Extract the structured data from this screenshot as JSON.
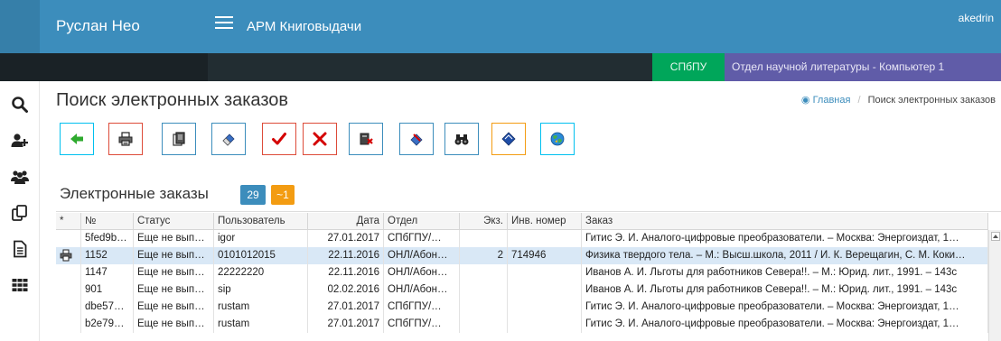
{
  "header": {
    "brand": "Руслан Нео",
    "app_title": "АРМ Книговыдачи",
    "user": "akedrin"
  },
  "infobar": {
    "org": "СПбПУ",
    "department": "Отдел научной литературы - Компьютер 1"
  },
  "sidebar": {
    "items": [
      "search-icon",
      "add-user-icon",
      "users-icon",
      "copy-icon",
      "document-icon",
      "grid-icon"
    ]
  },
  "page": {
    "title": "Поиск электронных заказов",
    "breadcrumb_home": "Главная",
    "breadcrumb_sep": "/",
    "breadcrumb_current": "Поиск электронных заказов"
  },
  "toolbar": {
    "buttons": [
      "back-arrow-icon",
      "print-icon",
      "copy-pages-icon",
      "eraser-icon",
      "checkmark-icon",
      "close-icon",
      "book-delete-icon",
      "book-mark-icon",
      "binoculars-icon",
      "diamond-icon",
      "globe-icon"
    ]
  },
  "section": {
    "title": "Электронные заказы",
    "count": "29",
    "new_count": "~1"
  },
  "grid": {
    "columns": [
      "*",
      "№",
      "Статус",
      "Пользователь",
      "Дата",
      "Отдел",
      "Экз.",
      "Инв. номер",
      "Заказ"
    ],
    "rows": [
      {
        "icon": "",
        "num": "5fed9b…",
        "status": "Еще не вып…",
        "user": "igor",
        "date": "27.01.2017",
        "dept": "СПбГПУ/…",
        "copies": "",
        "inv": "",
        "order": "Гитис Э. И. Аналого-цифровые преобразователи. – Москва: Энергоиздат, 1…"
      },
      {
        "icon": "printer",
        "num": "1152",
        "status": "Еще не вып…",
        "user": "0101012015",
        "date": "22.11.2016",
        "dept": "ОНЛ/Абон…",
        "copies": "2",
        "inv": "714946",
        "order": "Физика твердого тела. – М.: Высш.школа, 2011 / И. К. Верещагин, С. М. Коки…"
      },
      {
        "icon": "",
        "num": "1147",
        "status": "Еще не вып…",
        "user": "22222220",
        "date": "22.11.2016",
        "dept": "ОНЛ/Абон…",
        "copies": "",
        "inv": "",
        "order": "Иванов А. И. Льготы для работников Севера!!. – М.: Юрид. лит., 1991. – 143с"
      },
      {
        "icon": "",
        "num": "901",
        "status": "Еще не вып…",
        "user": "sip",
        "date": "02.02.2016",
        "dept": "ОНЛ/Абон…",
        "copies": "",
        "inv": "",
        "order": "Иванов А. И. Льготы для работников Севера!!. – М.: Юрид. лит., 1991. – 143с"
      },
      {
        "icon": "",
        "num": "dbe57…",
        "status": "Еще не вып…",
        "user": "rustam",
        "date": "27.01.2017",
        "dept": "СПбГПУ/…",
        "copies": "",
        "inv": "",
        "order": "Гитис Э. И. Аналого-цифровые преобразователи. – Москва: Энергоиздат, 1…"
      },
      {
        "icon": "",
        "num": "b2e79…",
        "status": "Еще не вып…",
        "user": "rustam",
        "date": "27.01.2017",
        "dept": "СПбГПУ/…",
        "copies": "",
        "inv": "",
        "order": "Гитис Э. И. Аналого-цифровые преобразователи. – Москва: Энергоиздат, 1…"
      }
    ]
  },
  "colors": {
    "primary": "#3c8dbc",
    "org_badge": "#00a65a",
    "dept_badge": "#605ca8",
    "count_badge": "#3c8dbc",
    "new_badge": "#f39c12",
    "selected_row": "#d9e8f6"
  }
}
